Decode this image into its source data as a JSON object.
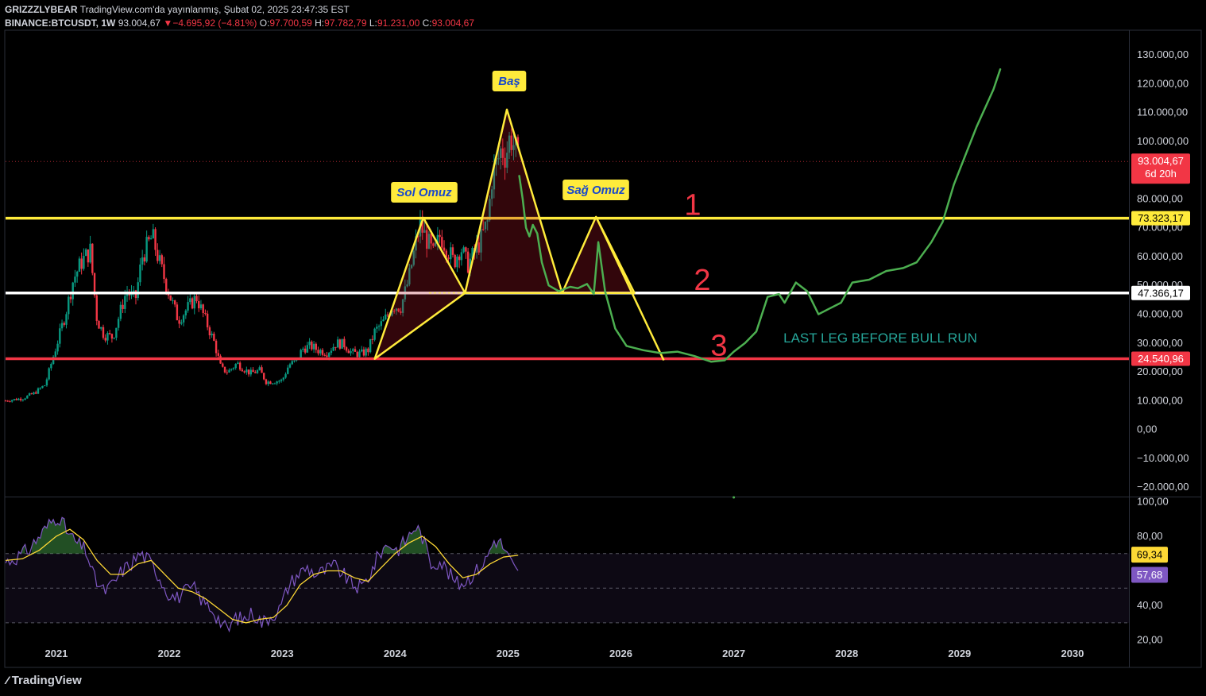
{
  "header": {
    "author": "GRIZZZLYBEAR",
    "published": "TradingView.com'da yayınlanmış, Şubat 02, 2025 23:47:35 EST",
    "symbol": "BINANCE:BTCUSDT, 1W",
    "last": "93.004,67",
    "change_arrow": "▼",
    "change": "−4.695,92 (−4.81%)",
    "o_label": "O:",
    "o": "97.700,59",
    "h_label": "H:",
    "h": "97.782,79",
    "l_label": "L:",
    "l": "91.231,00",
    "c_label": "C:",
    "c": "93.004,67"
  },
  "colors": {
    "background": "#000000",
    "up": "#089981",
    "down": "#f23645",
    "yellow": "#ffeb3b",
    "green_path": "#4caf50",
    "rsi": "#7e57c2",
    "rsi_ma": "#fdd835"
  },
  "chart_data": {
    "type": "candlestick",
    "price_axis": {
      "ticks": [
        130000,
        120000,
        110000,
        100000,
        90000,
        80000,
        70000,
        60000,
        50000,
        40000,
        30000,
        20000,
        10000,
        0,
        -10000,
        -20000
      ],
      "tick_labels": [
        "130.000,00",
        "120.000,00",
        "110.000,00",
        "100.000,00",
        "90.000,00",
        "80.000,00",
        "70.000,00",
        "60.000,00",
        "50.000,00",
        "40.000,00",
        "30.000,00",
        "20.000,00",
        "10.000,00",
        "0,00",
        "−10.000,00",
        "−20.000,00"
      ],
      "range": [
        -23000,
        138000
      ]
    },
    "time_axis": {
      "labels": [
        "2021",
        "2022",
        "2023",
        "2024",
        "2025",
        "2026",
        "2027",
        "2028",
        "2029",
        "2030"
      ],
      "range": [
        2020.55,
        2030.5
      ]
    },
    "current_price": {
      "value": 93004.67,
      "label": "93.004,67",
      "countdown": "6d 20h"
    },
    "levels": [
      {
        "value": 73323.17,
        "label": "73.323,17",
        "color": "#ffeb3b",
        "tag": "1"
      },
      {
        "value": 47366.17,
        "label": "47.366,17",
        "color": "#ffffff",
        "tag": "2"
      },
      {
        "value": 24540.96,
        "label": "24.540,96",
        "color": "#f23645",
        "tag": "3"
      }
    ],
    "price_path": [
      [
        2020.55,
        10000
      ],
      [
        2020.7,
        10800
      ],
      [
        2020.8,
        12500
      ],
      [
        2020.9,
        15500
      ],
      [
        2021.0,
        29000
      ],
      [
        2021.08,
        40000
      ],
      [
        2021.15,
        52000
      ],
      [
        2021.22,
        58000
      ],
      [
        2021.3,
        62000
      ],
      [
        2021.36,
        38000
      ],
      [
        2021.42,
        33000
      ],
      [
        2021.5,
        32000
      ],
      [
        2021.56,
        40000
      ],
      [
        2021.62,
        48000
      ],
      [
        2021.7,
        45000
      ],
      [
        2021.76,
        60000
      ],
      [
        2021.85,
        67000
      ],
      [
        2021.92,
        57000
      ],
      [
        2022.0,
        47000
      ],
      [
        2022.08,
        38000
      ],
      [
        2022.16,
        42000
      ],
      [
        2022.24,
        46000
      ],
      [
        2022.32,
        38000
      ],
      [
        2022.4,
        30000
      ],
      [
        2022.46,
        21000
      ],
      [
        2022.52,
        20000
      ],
      [
        2022.6,
        23000
      ],
      [
        2022.66,
        21000
      ],
      [
        2022.72,
        19500
      ],
      [
        2022.8,
        20500
      ],
      [
        2022.86,
        16500
      ],
      [
        2022.94,
        16800
      ],
      [
        2023.0,
        17000
      ],
      [
        2023.06,
        22500
      ],
      [
        2023.12,
        23500
      ],
      [
        2023.18,
        28000
      ],
      [
        2023.25,
        29000
      ],
      [
        2023.32,
        27500
      ],
      [
        2023.4,
        26800
      ],
      [
        2023.48,
        30000
      ],
      [
        2023.55,
        29500
      ],
      [
        2023.62,
        26500
      ],
      [
        2023.7,
        26200
      ],
      [
        2023.76,
        27500
      ],
      [
        2023.82,
        34000
      ],
      [
        2023.9,
        37500
      ],
      [
        2023.98,
        43000
      ],
      [
        2024.05,
        42500
      ],
      [
        2024.12,
        52000
      ],
      [
        2024.18,
        64000
      ],
      [
        2024.22,
        71000
      ],
      [
        2024.28,
        66000
      ],
      [
        2024.34,
        60500
      ],
      [
        2024.4,
        67500
      ],
      [
        2024.46,
        63000
      ],
      [
        2024.52,
        58000
      ],
      [
        2024.58,
        63500
      ],
      [
        2024.64,
        57000
      ],
      [
        2024.7,
        61000
      ],
      [
        2024.76,
        66000
      ],
      [
        2024.82,
        72000
      ],
      [
        2024.86,
        88000
      ],
      [
        2024.9,
        92000
      ],
      [
        2024.94,
        97500
      ],
      [
        2024.98,
        95000
      ],
      [
        2025.02,
        102000
      ],
      [
        2025.06,
        98000
      ],
      [
        2025.09,
        93004
      ]
    ],
    "pattern_labels": [
      {
        "key": "left",
        "text": "Sol Omuz"
      },
      {
        "key": "head",
        "text": "Baş"
      },
      {
        "key": "right",
        "text": "Sağ Omuz"
      }
    ],
    "annotation": "LAST LEG BEFORE BULL RUN",
    "rsi": {
      "ticks": [
        100,
        80,
        60,
        40,
        20
      ],
      "tick_labels": [
        "100,00",
        "80,00",
        "60,00",
        "40,00",
        "20,00"
      ],
      "range": [
        18,
        102
      ],
      "bands": [
        70,
        50,
        30
      ],
      "rsi_value": "57,68",
      "ma_value": "69,34",
      "rsi_series": [
        [
          2020.55,
          65
        ],
        [
          2020.65,
          68
        ],
        [
          2020.75,
          72
        ],
        [
          2020.85,
          80
        ],
        [
          2020.95,
          88
        ],
        [
          2021.02,
          92
        ],
        [
          2021.1,
          82
        ],
        [
          2021.18,
          76
        ],
        [
          2021.26,
          72
        ],
        [
          2021.34,
          55
        ],
        [
          2021.42,
          48
        ],
        [
          2021.5,
          52
        ],
        [
          2021.58,
          60
        ],
        [
          2021.66,
          64
        ],
        [
          2021.74,
          70
        ],
        [
          2021.82,
          66
        ],
        [
          2021.9,
          58
        ],
        [
          2021.98,
          48
        ],
        [
          2022.06,
          44
        ],
        [
          2022.14,
          48
        ],
        [
          2022.22,
          50
        ],
        [
          2022.3,
          42
        ],
        [
          2022.38,
          38
        ],
        [
          2022.46,
          30
        ],
        [
          2022.52,
          25
        ],
        [
          2022.58,
          33
        ],
        [
          2022.66,
          32
        ],
        [
          2022.74,
          36
        ],
        [
          2022.82,
          30
        ],
        [
          2022.9,
          34
        ],
        [
          2022.98,
          38
        ],
        [
          2023.06,
          52
        ],
        [
          2023.14,
          58
        ],
        [
          2023.22,
          62
        ],
        [
          2023.3,
          58
        ],
        [
          2023.38,
          60
        ],
        [
          2023.46,
          63
        ],
        [
          2023.54,
          58
        ],
        [
          2023.62,
          52
        ],
        [
          2023.7,
          50
        ],
        [
          2023.78,
          58
        ],
        [
          2023.86,
          70
        ],
        [
          2023.94,
          76
        ],
        [
          2024.02,
          72
        ],
        [
          2024.1,
          78
        ],
        [
          2024.18,
          86
        ],
        [
          2024.24,
          80
        ],
        [
          2024.32,
          64
        ],
        [
          2024.4,
          66
        ],
        [
          2024.48,
          58
        ],
        [
          2024.56,
          52
        ],
        [
          2024.64,
          55
        ],
        [
          2024.72,
          60
        ],
        [
          2024.8,
          66
        ],
        [
          2024.88,
          78
        ],
        [
          2024.94,
          76
        ],
        [
          2025.0,
          68
        ],
        [
          2025.05,
          62
        ],
        [
          2025.09,
          58
        ]
      ],
      "ma_series": [
        [
          2020.55,
          66
        ],
        [
          2020.7,
          67
        ],
        [
          2020.85,
          72
        ],
        [
          2021.0,
          80
        ],
        [
          2021.12,
          84
        ],
        [
          2021.24,
          78
        ],
        [
          2021.36,
          66
        ],
        [
          2021.48,
          58
        ],
        [
          2021.6,
          58
        ],
        [
          2021.72,
          64
        ],
        [
          2021.84,
          66
        ],
        [
          2021.96,
          58
        ],
        [
          2022.08,
          50
        ],
        [
          2022.2,
          48
        ],
        [
          2022.32,
          44
        ],
        [
          2022.44,
          38
        ],
        [
          2022.56,
          32
        ],
        [
          2022.68,
          30
        ],
        [
          2022.8,
          32
        ],
        [
          2022.92,
          33
        ],
        [
          2023.04,
          40
        ],
        [
          2023.16,
          52
        ],
        [
          2023.28,
          58
        ],
        [
          2023.4,
          60
        ],
        [
          2023.52,
          60
        ],
        [
          2023.64,
          56
        ],
        [
          2023.76,
          54
        ],
        [
          2023.88,
          62
        ],
        [
          2024.0,
          70
        ],
        [
          2024.12,
          76
        ],
        [
          2024.24,
          80
        ],
        [
          2024.36,
          74
        ],
        [
          2024.48,
          64
        ],
        [
          2024.6,
          56
        ],
        [
          2024.72,
          58
        ],
        [
          2024.84,
          64
        ],
        [
          2024.96,
          68
        ],
        [
          2025.09,
          69
        ]
      ]
    }
  },
  "footer": {
    "brand": "TradingView",
    "mark": "⁄⁄"
  }
}
